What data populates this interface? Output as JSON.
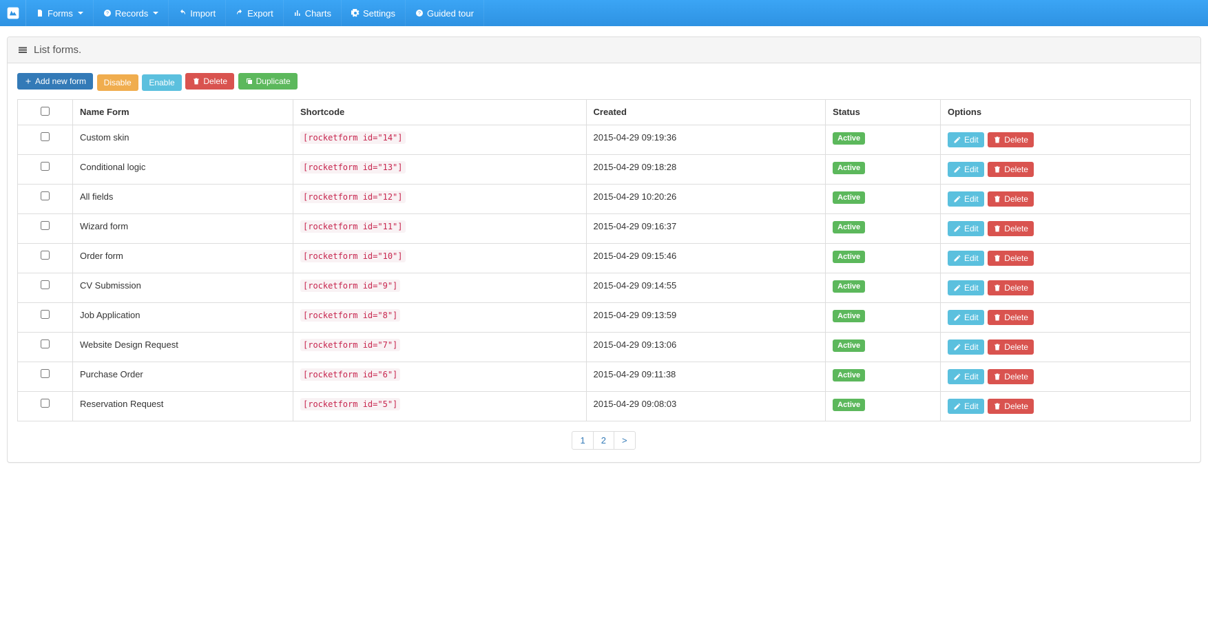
{
  "nav": {
    "items": [
      {
        "label": "Forms",
        "icon": "file",
        "caret": true
      },
      {
        "label": "Records",
        "icon": "question",
        "caret": true
      },
      {
        "label": "Import",
        "icon": "undo",
        "caret": false
      },
      {
        "label": "Export",
        "icon": "redo",
        "caret": false
      },
      {
        "label": "Charts",
        "icon": "chart",
        "caret": false
      },
      {
        "label": "Settings",
        "icon": "cog",
        "caret": false
      },
      {
        "label": "Guided tour",
        "icon": "question",
        "caret": false
      }
    ]
  },
  "page": {
    "title": "List forms."
  },
  "toolbar": {
    "add": "Add new form",
    "disable": "Disable",
    "enable": "Enable",
    "delete": "Delete",
    "duplicate": "Duplicate"
  },
  "table": {
    "headers": {
      "name": "Name Form",
      "shortcode": "Shortcode",
      "created": "Created",
      "status": "Status",
      "options": "Options"
    },
    "row_labels": {
      "edit": "Edit",
      "delete": "Delete",
      "active": "Active"
    },
    "rows": [
      {
        "name": "Custom skin",
        "shortcode": "[rocketform id=\"14\"]",
        "created": "2015-04-29 09:19:36",
        "status": "Active"
      },
      {
        "name": "Conditional logic",
        "shortcode": "[rocketform id=\"13\"]",
        "created": "2015-04-29 09:18:28",
        "status": "Active"
      },
      {
        "name": "All fields",
        "shortcode": "[rocketform id=\"12\"]",
        "created": "2015-04-29 10:20:26",
        "status": "Active"
      },
      {
        "name": "Wizard form",
        "shortcode": "[rocketform id=\"11\"]",
        "created": "2015-04-29 09:16:37",
        "status": "Active"
      },
      {
        "name": "Order form",
        "shortcode": "[rocketform id=\"10\"]",
        "created": "2015-04-29 09:15:46",
        "status": "Active"
      },
      {
        "name": "CV Submission",
        "shortcode": "[rocketform id=\"9\"]",
        "created": "2015-04-29 09:14:55",
        "status": "Active"
      },
      {
        "name": "Job Application",
        "shortcode": "[rocketform id=\"8\"]",
        "created": "2015-04-29 09:13:59",
        "status": "Active"
      },
      {
        "name": "Website Design Request",
        "shortcode": "[rocketform id=\"7\"]",
        "created": "2015-04-29 09:13:06",
        "status": "Active"
      },
      {
        "name": "Purchase Order",
        "shortcode": "[rocketform id=\"6\"]",
        "created": "2015-04-29 09:11:38",
        "status": "Active"
      },
      {
        "name": "Reservation Request",
        "shortcode": "[rocketform id=\"5\"]",
        "created": "2015-04-29 09:08:03",
        "status": "Active"
      }
    ]
  },
  "pagination": {
    "pages": [
      "1",
      "2",
      ">"
    ]
  }
}
